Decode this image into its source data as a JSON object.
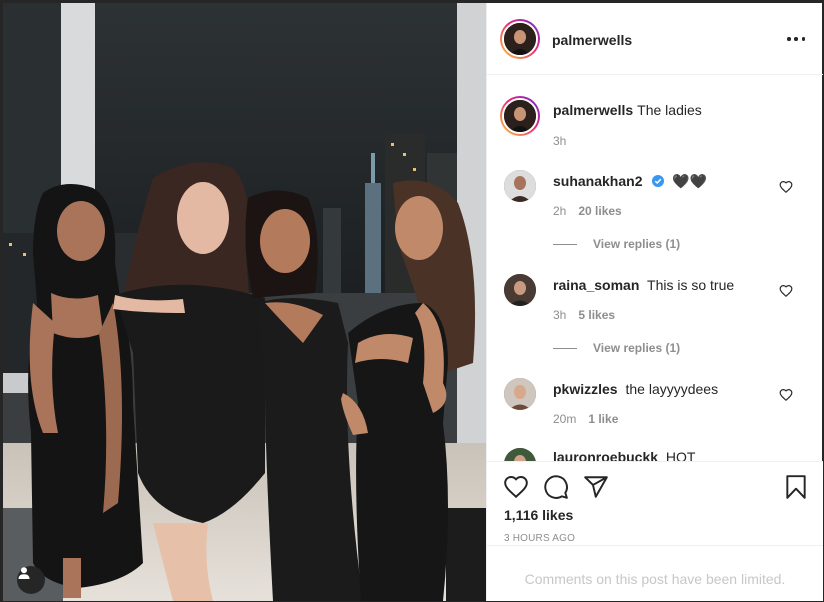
{
  "post": {
    "author": "palmerwells",
    "caption": "The ladies",
    "caption_time": "3h",
    "likes": "1,116 likes",
    "posted": "3 HOURS AGO",
    "comments_limited": "Comments on this post have been limited."
  },
  "comments": [
    {
      "user": "suhanakhan2",
      "text": "🖤🖤",
      "time": "2h",
      "likes": "20 likes",
      "verified": true,
      "replies": "View replies (1)"
    },
    {
      "user": "raina_soman",
      "text": "This is so true",
      "time": "3h",
      "likes": "5 likes",
      "verified": false,
      "replies": "View replies (1)"
    },
    {
      "user": "pkwizzles",
      "text": "the layyyydees",
      "time": "20m",
      "likes": "1 like",
      "verified": false
    },
    {
      "user": "lauronroebuckk",
      "text": "HOT",
      "verified": false
    }
  ],
  "icons": {
    "more": "more-options-icon",
    "like": "heart-icon",
    "comment": "comment-icon",
    "share": "share-icon",
    "save": "bookmark-icon",
    "verified": "verified-badge-icon",
    "tag": "user-tag-icon"
  },
  "colors": {
    "verified": "#3897f0",
    "story_ring_start": "#f9ce34",
    "story_ring_mid": "#ee2a7b",
    "story_ring_end": "#6228d7"
  }
}
